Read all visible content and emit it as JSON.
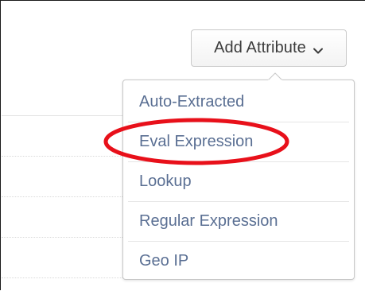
{
  "toolbar": {
    "add_attribute_label": "Add Attribute",
    "chevron_icon": "chevron-down-icon"
  },
  "menu": {
    "items": [
      {
        "label": "Auto-Extracted"
      },
      {
        "label": "Eval Expression"
      },
      {
        "label": "Lookup"
      },
      {
        "label": "Regular Expression"
      },
      {
        "label": "Geo IP"
      }
    ],
    "highlighted_item": "Eval Expression"
  },
  "colors": {
    "menu_text": "#5a6f93",
    "highlight_ring": "#e8101a",
    "button_text": "#3c3c3c"
  }
}
